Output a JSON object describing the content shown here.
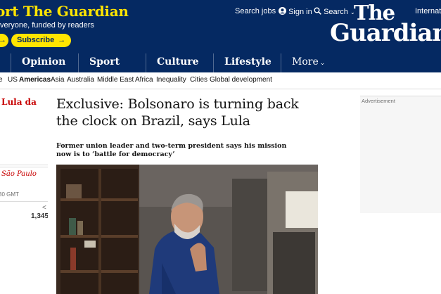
{
  "masthead": {
    "support_text": "ort The Guardian",
    "tagline": "veryone, funded by readers",
    "subscribe_label": "Subscribe",
    "top_links": {
      "search_jobs": "Search jobs",
      "sign_in": "Sign in",
      "search": "Search",
      "edition": "Internatio"
    },
    "logo_line1": "The",
    "logo_line2": "Guardian"
  },
  "nav": {
    "items": [
      "Opinion",
      "Sport",
      "Culture",
      "Lifestyle",
      "More"
    ]
  },
  "subnav": {
    "items": [
      "e",
      "US",
      "Americas",
      "Asia",
      "Australia",
      "Middle East",
      "Africa",
      "Inequality",
      "Cities",
      "Global development"
    ]
  },
  "left_column": {
    "headline": "Lula da",
    "location": "São Paulo",
    "time": "30 GMT",
    "share_count": "1,345"
  },
  "article": {
    "headline": "Exclusive: Bolsonaro is turning back the clock on Brazil, says Lula",
    "standfirst": "Former union leader and two-term president says his mission now is to ‘battle for democracy’"
  },
  "ad": {
    "label": "Advertisement"
  },
  "colors": {
    "brand_blue": "#052962",
    "brand_yellow": "#ffe500",
    "news_red": "#c70000"
  }
}
